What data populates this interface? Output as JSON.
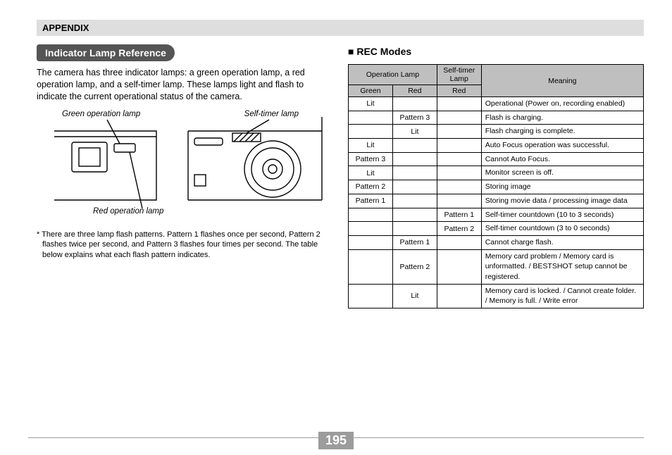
{
  "appendix": "APPENDIX",
  "section": {
    "title": "Indicator Lamp Reference",
    "intro": "The camera has three indicator lamps: a green operation lamp, a red operation lamp, and a self-timer lamp. These lamps light and flash to indicate the current operational status of the camera.",
    "labels": {
      "green": "Green operation lamp",
      "red": "Red operation lamp",
      "timer": "Self-timer lamp"
    },
    "footnote": "There are three lamp flash patterns. Pattern 1 flashes once per second, Pattern 2 flashes twice per second, and Pattern 3 flashes four times per second. The table below explains what each flash pattern indicates."
  },
  "rec": {
    "title": "REC Modes",
    "headers": {
      "op_lamp": "Operation Lamp",
      "timer_lamp": "Self-timer Lamp",
      "green": "Green",
      "red": "Red",
      "red2": "Red",
      "meaning": "Meaning"
    },
    "rows": [
      {
        "green": "Lit",
        "red": "",
        "timer": "",
        "meaning": "Operational (Power on, recording enabled)"
      },
      {
        "green": "",
        "red": "Pattern 3",
        "timer": "",
        "meaning": "Flash is charging."
      },
      {
        "green": "",
        "red": "Lit",
        "timer": "",
        "meaning": "Flash charging is complete."
      },
      {
        "green": "Lit",
        "red": "",
        "timer": "",
        "meaning": "Auto Focus operation was successful."
      },
      {
        "green": "Pattern 3",
        "red": "",
        "timer": "",
        "meaning": "Cannot Auto Focus."
      },
      {
        "green": "Lit",
        "red": "",
        "timer": "",
        "meaning": "Monitor screen is off."
      },
      {
        "green": "Pattern 2",
        "red": "",
        "timer": "",
        "meaning": "Storing image"
      },
      {
        "green": "Pattern 1",
        "red": "",
        "timer": "",
        "meaning": "Storing movie data / processing image data"
      },
      {
        "green": "",
        "red": "",
        "timer": "Pattern 1",
        "meaning": "Self-timer countdown (10 to 3 seconds)"
      },
      {
        "green": "",
        "red": "",
        "timer": "Pattern 2",
        "meaning": "Self-timer countdown (3 to 0 seconds)"
      },
      {
        "green": "",
        "red": "Pattern 1",
        "timer": "",
        "meaning": "Cannot charge flash."
      },
      {
        "green": "",
        "red": "Pattern 2",
        "timer": "",
        "meaning": "Memory card problem / Memory card is unformatted. / BESTSHOT setup cannot be registered."
      },
      {
        "green": "",
        "red": "Lit",
        "timer": "",
        "meaning": "Memory card is locked. / Cannot create folder. / Memory is full. / Write error"
      }
    ]
  },
  "page_number": "195"
}
